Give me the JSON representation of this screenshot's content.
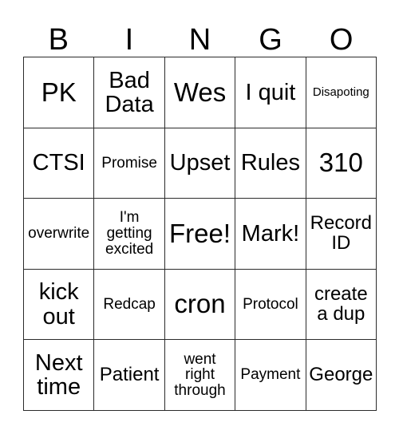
{
  "card": {
    "headers": [
      "B",
      "I",
      "N",
      "G",
      "O"
    ],
    "rows": [
      [
        {
          "text": "PK",
          "size": "fs-xl"
        },
        {
          "text": "Bad\nData",
          "size": "fs-lg"
        },
        {
          "text": "Wes",
          "size": "fs-xl"
        },
        {
          "text": "I quit",
          "size": "fs-lg"
        },
        {
          "text": "Disapoting",
          "size": "fs-xs"
        }
      ],
      [
        {
          "text": "CTSI",
          "size": "fs-lg"
        },
        {
          "text": "Promise",
          "size": "fs-sm"
        },
        {
          "text": "Upset",
          "size": "fs-lg"
        },
        {
          "text": "Rules",
          "size": "fs-lg"
        },
        {
          "text": "310",
          "size": "fs-xl"
        }
      ],
      [
        {
          "text": "overwrite",
          "size": "fs-sm"
        },
        {
          "text": "I'm\ngetting\nexcited",
          "size": "fs-sm"
        },
        {
          "text": "Free!",
          "size": "fs-xl"
        },
        {
          "text": "Mark!",
          "size": "fs-lg"
        },
        {
          "text": "Record\nID",
          "size": "fs-md"
        }
      ],
      [
        {
          "text": "kick\nout",
          "size": "fs-lg"
        },
        {
          "text": "Redcap",
          "size": "fs-sm"
        },
        {
          "text": "cron",
          "size": "fs-xl"
        },
        {
          "text": "Protocol",
          "size": "fs-sm"
        },
        {
          "text": "create\na dup",
          "size": "fs-md"
        }
      ],
      [
        {
          "text": "Next\ntime",
          "size": "fs-lg"
        },
        {
          "text": "Patient",
          "size": "fs-md"
        },
        {
          "text": "went\nright\nthrough",
          "size": "fs-sm"
        },
        {
          "text": "Payment",
          "size": "fs-sm"
        },
        {
          "text": "George",
          "size": "fs-md"
        }
      ]
    ],
    "free_space": {
      "row": 2,
      "col": 2,
      "label": "Free!"
    },
    "colors": {
      "background": "#ffffff",
      "text": "#000000",
      "border": "#2b2b2b"
    }
  }
}
